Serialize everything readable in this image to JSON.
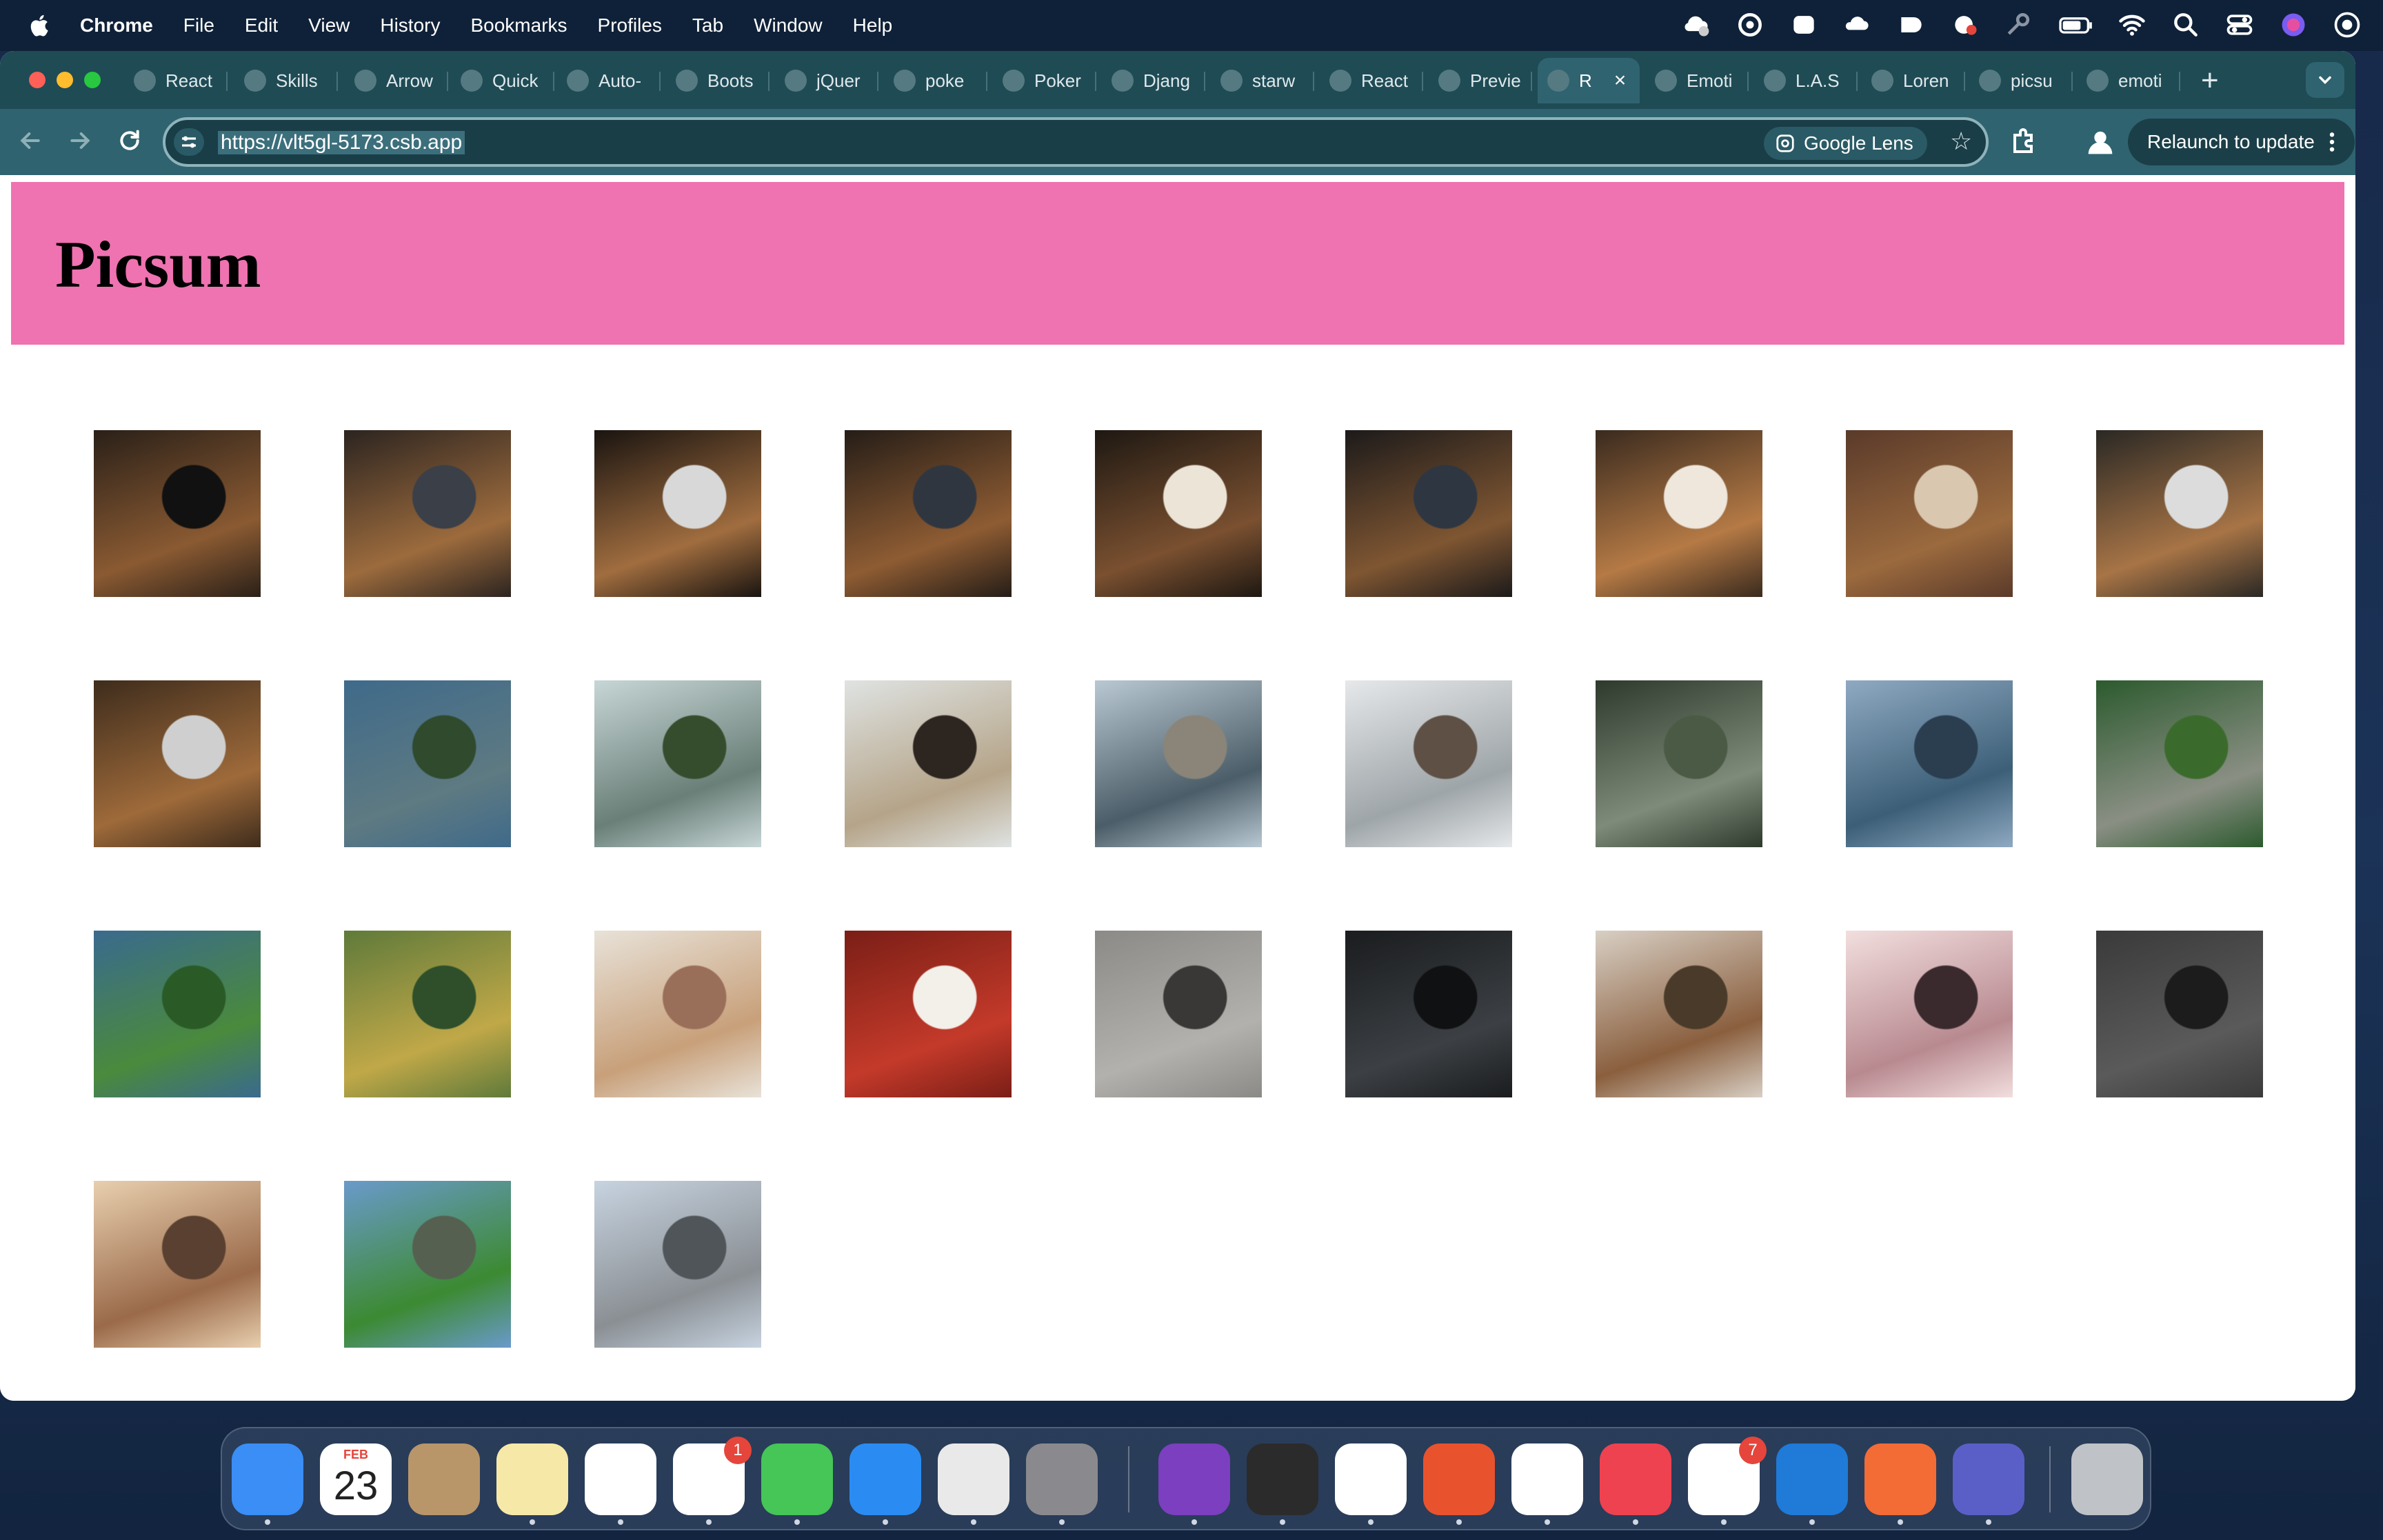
{
  "menubar": {
    "app_name": "Chrome",
    "items": [
      "File",
      "Edit",
      "View",
      "History",
      "Bookmarks",
      "Profiles",
      "Tab",
      "Window",
      "Help"
    ]
  },
  "tabs": [
    {
      "label": "React"
    },
    {
      "label": "Skills"
    },
    {
      "label": "Arrow"
    },
    {
      "label": "Quick"
    },
    {
      "label": "Auto-"
    },
    {
      "label": "Boots"
    },
    {
      "label": "jQuer"
    },
    {
      "label": "poke"
    },
    {
      "label": "Poker"
    },
    {
      "label": "Djang"
    },
    {
      "label": "starw"
    },
    {
      "label": "React"
    },
    {
      "label": "Previe"
    },
    {
      "label": "R",
      "active": true
    },
    {
      "label": "Emoti"
    },
    {
      "label": "L.A.S"
    },
    {
      "label": "Loren"
    },
    {
      "label": "picsu"
    },
    {
      "label": "emoti"
    }
  ],
  "toolbar": {
    "url": "https://vlt5gl-5173.csb.app",
    "lens_label": "Google Lens",
    "relaunch_label": "Relaunch to update"
  },
  "page": {
    "title": "Picsum"
  },
  "gallery": {
    "count": 30,
    "tones": [
      [
        "#2a2018",
        "#8a5a32",
        "#111111"
      ],
      [
        "#2c2420",
        "#9c6b3d",
        "#3a3f48"
      ],
      [
        "#1a1410",
        "#a06d3f",
        "#d8d8d8"
      ],
      [
        "#251d17",
        "#8e5c33",
        "#2f3640"
      ],
      [
        "#1e1812",
        "#7a5030",
        "#ece4d6"
      ],
      [
        "#1c1a1a",
        "#7f5632",
        "#2e3642"
      ],
      [
        "#3a2a1e",
        "#b57a45",
        "#efe6dc"
      ],
      [
        "#5a3a2a",
        "#9b6a3e",
        "#d9c7b0"
      ],
      [
        "#2a2824",
        "#a77446",
        "#dcdcdc"
      ],
      [
        "#3e2c1c",
        "#9e6a3a",
        "#cfcfcf"
      ],
      [
        "#3f6a8a",
        "#5e7a82",
        "#2f4a2c"
      ],
      [
        "#c7d6d6",
        "#6a7f78",
        "#354d2d"
      ],
      [
        "#dfe3e2",
        "#b5a489",
        "#2c2520"
      ],
      [
        "#b9c8d2",
        "#4b5d68",
        "#8b8478"
      ],
      [
        "#e6e8ea",
        "#9ea5a8",
        "#5e5045"
      ],
      [
        "#2e3a2c",
        "#7e8b7a",
        "#4a5a44"
      ],
      [
        "#8fa9c2",
        "#3c5f77",
        "#2a3e4f"
      ],
      [
        "#2c5a2e",
        "#8a8f84",
        "#3b6b2c"
      ],
      [
        "#3a6a8e",
        "#4a8a3c",
        "#2a5a26"
      ],
      [
        "#5f7a3a",
        "#c0a848",
        "#2e4f2a"
      ],
      [
        "#e8e2d8",
        "#c8a07a",
        "#9a6f5a"
      ],
      [
        "#7a1e16",
        "#c43a2a",
        "#f3efe9"
      ],
      [
        "#8c8a86",
        "#b3b1ad",
        "#3a3836"
      ],
      [
        "#1a1c1e",
        "#3c4044",
        "#101112"
      ],
      [
        "#d8cfc4",
        "#8a5f3e",
        "#4a3a2a"
      ],
      [
        "#f2dede",
        "#b88a90",
        "#3a2a2e"
      ],
      [
        "#3a3a3a",
        "#5a5a5a",
        "#1c1c1c"
      ],
      [
        "#e8cfae",
        "#9a6a4a",
        "#5a4030"
      ],
      [
        "#6a9acb",
        "#3c8a32",
        "#556050"
      ],
      [
        "#c7d3e0",
        "#8a8f94",
        "#4f5559"
      ]
    ]
  },
  "dock": {
    "calendar_month": "FEB",
    "calendar_day": "23",
    "reminders_badge": "1",
    "store_badge": "7",
    "apps": [
      {
        "name": "finder-icon",
        "color": "#3a8ef5"
      },
      {
        "name": "calendar-icon",
        "color": "#ffffff"
      },
      {
        "name": "contacts-icon",
        "color": "#b8966a"
      },
      {
        "name": "notes-icon",
        "color": "#f6e9a8"
      },
      {
        "name": "freeform-icon",
        "color": "#ffffff"
      },
      {
        "name": "reminders-icon",
        "color": "#ffffff"
      },
      {
        "name": "messages-icon",
        "color": "#45c657"
      },
      {
        "name": "app-store-icon",
        "color": "#2a8cf3"
      },
      {
        "name": "chrome-icon",
        "color": "#e9e9e9"
      },
      {
        "name": "system-settings-icon",
        "color": "#8a8a8e"
      },
      {
        "name": "github-desktop-icon",
        "color": "#7b3fc0"
      },
      {
        "name": "terminal-icon",
        "color": "#2b2b2b"
      },
      {
        "name": "slack-icon",
        "color": "#ffffff"
      },
      {
        "name": "remote-desktop-icon",
        "color": "#e8532e"
      },
      {
        "name": "tandem-icon",
        "color": "#ffffff"
      },
      {
        "name": "brave-icon",
        "color": "#ef4250"
      },
      {
        "name": "office-icon",
        "color": "#ffffff"
      },
      {
        "name": "vscode-icon",
        "color": "#1f7ad8"
      },
      {
        "name": "postman-icon",
        "color": "#f36c36"
      },
      {
        "name": "teams-icon",
        "color": "#5a5fc8"
      },
      {
        "name": "trash-icon",
        "color": "#bfc3c7"
      }
    ]
  }
}
